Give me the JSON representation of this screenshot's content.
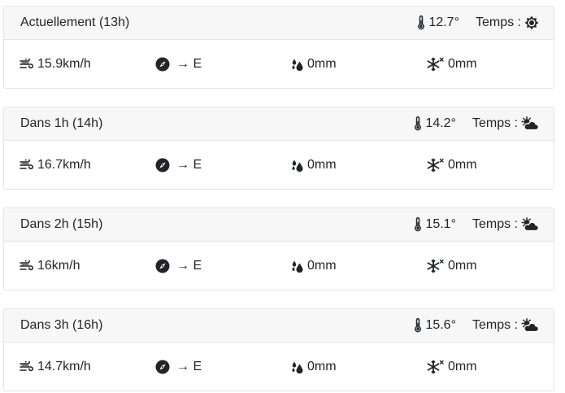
{
  "forecasts": [
    {
      "title": "Actuellement (13h)",
      "temperature": "12.7°",
      "weather_label": "Temps :",
      "weather_icon": "sun-icon",
      "wind_speed": "15.9km/h",
      "wind_direction": "→ E",
      "rain": "0mm",
      "snow": "0mm"
    },
    {
      "title": "Dans 1h (14h)",
      "temperature": "14.2°",
      "weather_label": "Temps :",
      "weather_icon": "cloud-sun-icon",
      "wind_speed": "16.7km/h",
      "wind_direction": "→ E",
      "rain": "0mm",
      "snow": "0mm"
    },
    {
      "title": "Dans 2h (15h)",
      "temperature": "15.1°",
      "weather_label": "Temps :",
      "weather_icon": "cloud-sun-icon",
      "wind_speed": "16km/h",
      "wind_direction": "→ E",
      "rain": "0mm",
      "snow": "0mm"
    },
    {
      "title": "Dans 3h (16h)",
      "temperature": "15.6°",
      "weather_label": "Temps :",
      "weather_icon": "cloud-sun-icon",
      "wind_speed": "14.7km/h",
      "wind_direction": "→ E",
      "rain": "0mm",
      "snow": "0mm"
    }
  ]
}
